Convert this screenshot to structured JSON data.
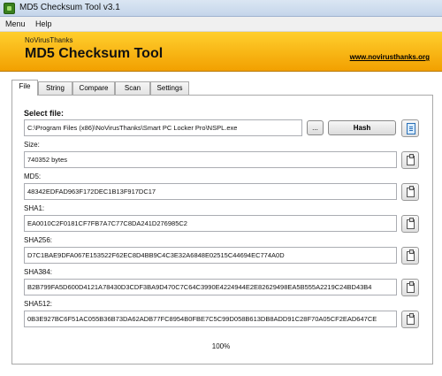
{
  "window": {
    "title": "MD5 Checksum Tool v3.1"
  },
  "menu": {
    "items": [
      "Menu",
      "Help"
    ]
  },
  "banner": {
    "brand": "NoVirusThanks",
    "heading": "MD5 Checksum Tool",
    "link": "www.novirusthanks.org"
  },
  "tabs": [
    "File",
    "String",
    "Compare",
    "Scan",
    "Settings"
  ],
  "file": {
    "select_label": "Select file:",
    "path": "C:\\Program Files (x86)\\NoVirusThanks\\Smart PC Locker Pro\\NSPL.exe",
    "browse_label": "...",
    "hash_label": "Hash"
  },
  "results": [
    {
      "label": "Size:",
      "value": "740352 bytes"
    },
    {
      "label": "MD5:",
      "value": "48342EDFAD963F172DEC1B13F917DC17"
    },
    {
      "label": "SHA1:",
      "value": "EA0010C2F0181CF7FB7A7C77C8DA241D276985C2"
    },
    {
      "label": "SHA256:",
      "value": "D7C1BAE9DFA067E153522F62EC8D4BB9C4C3E32A6848E02515C44694EC774A0D"
    },
    {
      "label": "SHA384:",
      "value": "B2B799FA5D600D4121A78430D3CDF3BA9D470C7C64C3990E4224944E2E82629498EA5B555A2219C24BD43B4"
    },
    {
      "label": "SHA512:",
      "value": "0B3E927BC6F51AC055B36B73DA62ADB77FC8954B0FBE7C5C99D058B613DB8ADD91C28F70A05CF2EAD647CE"
    }
  ],
  "progress": {
    "text": "100%",
    "fraction": 1.0
  },
  "icons": {
    "app": "app-icon",
    "copy": "clipboard-icon",
    "open": "document-icon"
  },
  "colors": {
    "banner_top": "#ffcf2e",
    "banner_bottom": "#f2a000",
    "titlebar": "#c4d5ea"
  }
}
